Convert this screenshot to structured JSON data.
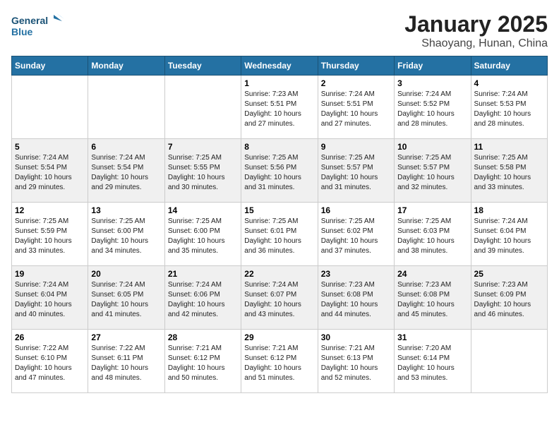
{
  "logo": {
    "line1": "General",
    "line2": "Blue"
  },
  "title": "January 2025",
  "subtitle": "Shaoyang, Hunan, China",
  "weekdays": [
    "Sunday",
    "Monday",
    "Tuesday",
    "Wednesday",
    "Thursday",
    "Friday",
    "Saturday"
  ],
  "weeks": [
    [
      {
        "day": "",
        "info": ""
      },
      {
        "day": "",
        "info": ""
      },
      {
        "day": "",
        "info": ""
      },
      {
        "day": "1",
        "info": "Sunrise: 7:23 AM\nSunset: 5:51 PM\nDaylight: 10 hours\nand 27 minutes."
      },
      {
        "day": "2",
        "info": "Sunrise: 7:24 AM\nSunset: 5:51 PM\nDaylight: 10 hours\nand 27 minutes."
      },
      {
        "day": "3",
        "info": "Sunrise: 7:24 AM\nSunset: 5:52 PM\nDaylight: 10 hours\nand 28 minutes."
      },
      {
        "day": "4",
        "info": "Sunrise: 7:24 AM\nSunset: 5:53 PM\nDaylight: 10 hours\nand 28 minutes."
      }
    ],
    [
      {
        "day": "5",
        "info": "Sunrise: 7:24 AM\nSunset: 5:54 PM\nDaylight: 10 hours\nand 29 minutes."
      },
      {
        "day": "6",
        "info": "Sunrise: 7:24 AM\nSunset: 5:54 PM\nDaylight: 10 hours\nand 29 minutes."
      },
      {
        "day": "7",
        "info": "Sunrise: 7:25 AM\nSunset: 5:55 PM\nDaylight: 10 hours\nand 30 minutes."
      },
      {
        "day": "8",
        "info": "Sunrise: 7:25 AM\nSunset: 5:56 PM\nDaylight: 10 hours\nand 31 minutes."
      },
      {
        "day": "9",
        "info": "Sunrise: 7:25 AM\nSunset: 5:57 PM\nDaylight: 10 hours\nand 31 minutes."
      },
      {
        "day": "10",
        "info": "Sunrise: 7:25 AM\nSunset: 5:57 PM\nDaylight: 10 hours\nand 32 minutes."
      },
      {
        "day": "11",
        "info": "Sunrise: 7:25 AM\nSunset: 5:58 PM\nDaylight: 10 hours\nand 33 minutes."
      }
    ],
    [
      {
        "day": "12",
        "info": "Sunrise: 7:25 AM\nSunset: 5:59 PM\nDaylight: 10 hours\nand 33 minutes."
      },
      {
        "day": "13",
        "info": "Sunrise: 7:25 AM\nSunset: 6:00 PM\nDaylight: 10 hours\nand 34 minutes."
      },
      {
        "day": "14",
        "info": "Sunrise: 7:25 AM\nSunset: 6:00 PM\nDaylight: 10 hours\nand 35 minutes."
      },
      {
        "day": "15",
        "info": "Sunrise: 7:25 AM\nSunset: 6:01 PM\nDaylight: 10 hours\nand 36 minutes."
      },
      {
        "day": "16",
        "info": "Sunrise: 7:25 AM\nSunset: 6:02 PM\nDaylight: 10 hours\nand 37 minutes."
      },
      {
        "day": "17",
        "info": "Sunrise: 7:25 AM\nSunset: 6:03 PM\nDaylight: 10 hours\nand 38 minutes."
      },
      {
        "day": "18",
        "info": "Sunrise: 7:24 AM\nSunset: 6:04 PM\nDaylight: 10 hours\nand 39 minutes."
      }
    ],
    [
      {
        "day": "19",
        "info": "Sunrise: 7:24 AM\nSunset: 6:04 PM\nDaylight: 10 hours\nand 40 minutes."
      },
      {
        "day": "20",
        "info": "Sunrise: 7:24 AM\nSunset: 6:05 PM\nDaylight: 10 hours\nand 41 minutes."
      },
      {
        "day": "21",
        "info": "Sunrise: 7:24 AM\nSunset: 6:06 PM\nDaylight: 10 hours\nand 42 minutes."
      },
      {
        "day": "22",
        "info": "Sunrise: 7:24 AM\nSunset: 6:07 PM\nDaylight: 10 hours\nand 43 minutes."
      },
      {
        "day": "23",
        "info": "Sunrise: 7:23 AM\nSunset: 6:08 PM\nDaylight: 10 hours\nand 44 minutes."
      },
      {
        "day": "24",
        "info": "Sunrise: 7:23 AM\nSunset: 6:08 PM\nDaylight: 10 hours\nand 45 minutes."
      },
      {
        "day": "25",
        "info": "Sunrise: 7:23 AM\nSunset: 6:09 PM\nDaylight: 10 hours\nand 46 minutes."
      }
    ],
    [
      {
        "day": "26",
        "info": "Sunrise: 7:22 AM\nSunset: 6:10 PM\nDaylight: 10 hours\nand 47 minutes."
      },
      {
        "day": "27",
        "info": "Sunrise: 7:22 AM\nSunset: 6:11 PM\nDaylight: 10 hours\nand 48 minutes."
      },
      {
        "day": "28",
        "info": "Sunrise: 7:21 AM\nSunset: 6:12 PM\nDaylight: 10 hours\nand 50 minutes."
      },
      {
        "day": "29",
        "info": "Sunrise: 7:21 AM\nSunset: 6:12 PM\nDaylight: 10 hours\nand 51 minutes."
      },
      {
        "day": "30",
        "info": "Sunrise: 7:21 AM\nSunset: 6:13 PM\nDaylight: 10 hours\nand 52 minutes."
      },
      {
        "day": "31",
        "info": "Sunrise: 7:20 AM\nSunset: 6:14 PM\nDaylight: 10 hours\nand 53 minutes."
      },
      {
        "day": "",
        "info": ""
      }
    ]
  ]
}
